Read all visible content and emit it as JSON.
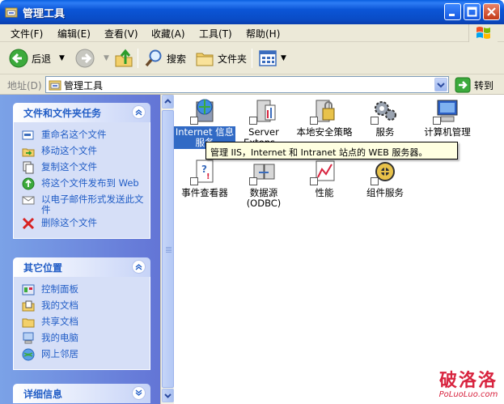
{
  "window": {
    "title": "管理工具"
  },
  "menu": [
    "文件(F)",
    "编辑(E)",
    "查看(V)",
    "收藏(A)",
    "工具(T)",
    "帮助(H)"
  ],
  "toolbar": {
    "back": "后退",
    "search": "搜索",
    "folders": "文件夹"
  },
  "address": {
    "label": "地址(D)",
    "value": "管理工具",
    "go": "转到"
  },
  "task_panel": {
    "title": "文件和文件夹任务",
    "tasks": [
      "重命名这个文件",
      "移动这个文件",
      "复制这个文件",
      "将这个文件发布到 Web",
      "以电子邮件形式发送此文件",
      "删除这个文件"
    ]
  },
  "other_places": {
    "title": "其它位置",
    "items": [
      "控制面板",
      "我的文档",
      "共享文档",
      "我的电脑",
      "网上邻居"
    ]
  },
  "details": {
    "title": "详细信息"
  },
  "files": [
    {
      "label": "Internet 信息服务",
      "icon": "iis-icon",
      "selected": true
    },
    {
      "label": "Server Extens...",
      "icon": "server-extensions-icon"
    },
    {
      "label": "本地安全策略",
      "icon": "local-security-icon"
    },
    {
      "label": "服务",
      "icon": "services-icon"
    },
    {
      "label": "计算机管理",
      "icon": "computer-management-icon"
    },
    {
      "label": "事件查看器",
      "icon": "event-viewer-icon"
    },
    {
      "label": "数据源 (ODBC)",
      "icon": "odbc-icon"
    },
    {
      "label": "性能",
      "icon": "performance-icon"
    },
    {
      "label": "组件服务",
      "icon": "component-services-icon"
    }
  ],
  "tooltip": "管理 IIS，Internet 和 Intranet 站点的 WEB 服务器。",
  "watermark": {
    "line1": "破洛洛",
    "line2": "PoLuoLuo.com"
  },
  "colors": {
    "titlebar": "#0a4cc6",
    "taskpane": "#6e8fe0",
    "selection": "#316ac5",
    "tooltip_bg": "#ffffe1"
  }
}
